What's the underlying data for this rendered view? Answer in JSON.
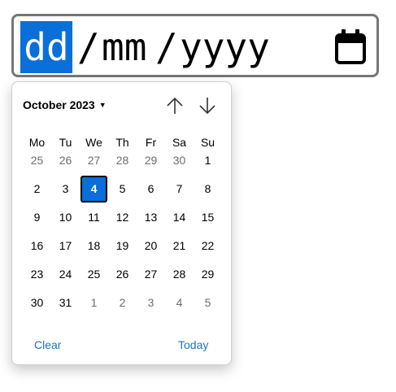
{
  "date_input": {
    "day_placeholder": "dd",
    "separator": "/",
    "month_placeholder": "mm",
    "year_placeholder": "yyyy",
    "calendar_icon": "calendar-icon"
  },
  "calendar": {
    "month_label": "October 2023",
    "dropdown_icon": "caret-down-icon",
    "prev_icon": "arrow-up-icon",
    "next_icon": "arrow-down-icon",
    "weekdays": [
      "Mo",
      "Tu",
      "We",
      "Th",
      "Fr",
      "Sa",
      "Su"
    ],
    "weeks": [
      [
        {
          "d": "25",
          "other": true
        },
        {
          "d": "26",
          "other": true
        },
        {
          "d": "27",
          "other": true
        },
        {
          "d": "28",
          "other": true
        },
        {
          "d": "29",
          "other": true
        },
        {
          "d": "30",
          "other": true
        },
        {
          "d": "1"
        }
      ],
      [
        {
          "d": "2"
        },
        {
          "d": "3"
        },
        {
          "d": "4",
          "selected": true
        },
        {
          "d": "5"
        },
        {
          "d": "6"
        },
        {
          "d": "7"
        },
        {
          "d": "8"
        }
      ],
      [
        {
          "d": "9"
        },
        {
          "d": "10"
        },
        {
          "d": "11"
        },
        {
          "d": "12"
        },
        {
          "d": "13"
        },
        {
          "d": "14"
        },
        {
          "d": "15"
        }
      ],
      [
        {
          "d": "16"
        },
        {
          "d": "17"
        },
        {
          "d": "18"
        },
        {
          "d": "19"
        },
        {
          "d": "20"
        },
        {
          "d": "21"
        },
        {
          "d": "22"
        }
      ],
      [
        {
          "d": "23"
        },
        {
          "d": "24"
        },
        {
          "d": "25"
        },
        {
          "d": "26"
        },
        {
          "d": "27"
        },
        {
          "d": "28"
        },
        {
          "d": "29"
        }
      ],
      [
        {
          "d": "30"
        },
        {
          "d": "31"
        },
        {
          "d": "1",
          "other": true
        },
        {
          "d": "2",
          "other": true
        },
        {
          "d": "3",
          "other": true
        },
        {
          "d": "4",
          "other": true
        },
        {
          "d": "5",
          "other": true
        }
      ]
    ],
    "clear_label": "Clear",
    "today_label": "Today"
  },
  "colors": {
    "accent": "#0a6fd8",
    "link": "#1a73c8",
    "muted_text": "#6d6d6d",
    "border": "#767676"
  }
}
